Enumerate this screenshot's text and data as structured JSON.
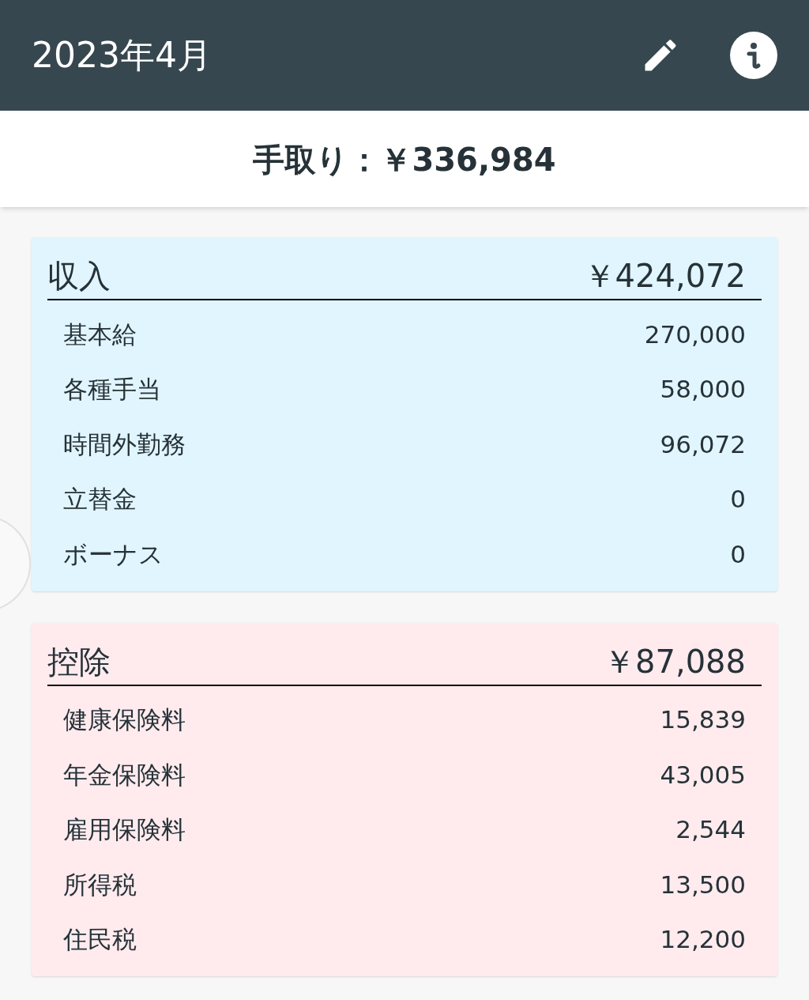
{
  "header": {
    "title": "2023年4月"
  },
  "net_pay": {
    "label": "手取り：",
    "amount": "￥336,984"
  },
  "sections": [
    {
      "title": "収入",
      "total": "￥424,072",
      "color": "#e1f5fe",
      "rows": [
        {
          "label": "基本給",
          "value": "270,000"
        },
        {
          "label": "各種手当",
          "value": "58,000"
        },
        {
          "label": "時間外勤務",
          "value": "96,072"
        },
        {
          "label": "立替金",
          "value": "0"
        },
        {
          "label": "ボーナス",
          "value": "0"
        }
      ]
    },
    {
      "title": "控除",
      "total": "￥87,088",
      "color": "#ffebee",
      "rows": [
        {
          "label": "健康保険料",
          "value": "15,839"
        },
        {
          "label": "年金保険料",
          "value": "43,005"
        },
        {
          "label": "雇用保険料",
          "value": "2,544"
        },
        {
          "label": "所得税",
          "value": "13,500"
        },
        {
          "label": "住民税",
          "value": "12,200"
        }
      ]
    }
  ]
}
